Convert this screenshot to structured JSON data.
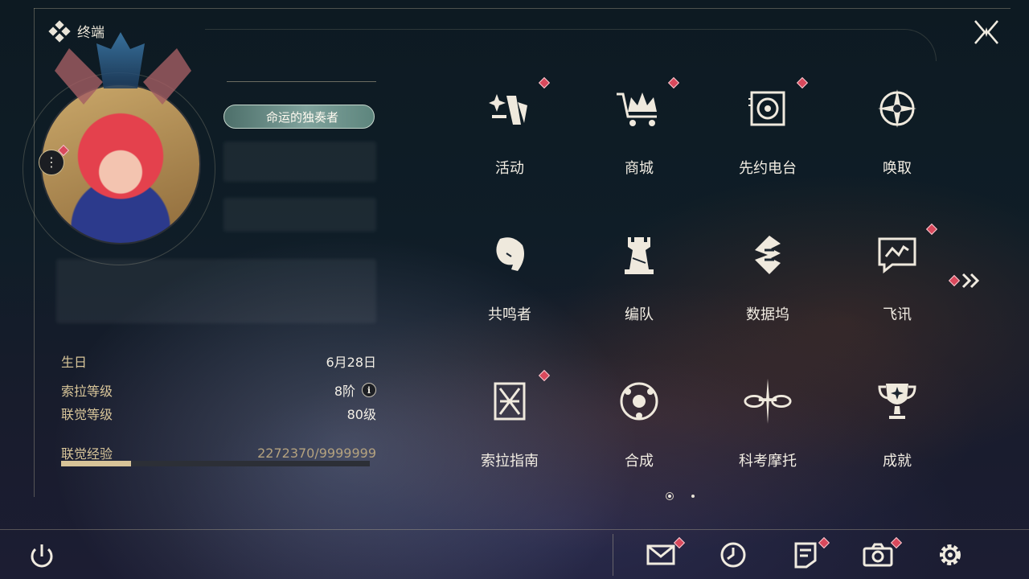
{
  "header": {
    "title": "终端",
    "logo_icon": "diamond-grid-icon"
  },
  "profile": {
    "title_chip": "命运的独奏者",
    "info": {
      "birthday_label": "生日",
      "birthday_value": "6月28日",
      "sola_level_label": "索拉等级",
      "sola_level_value": "8阶",
      "sync_level_label": "联觉等级",
      "sync_level_value": "80级",
      "exp_label": "联觉经验",
      "exp_value": "2272370/9999999",
      "exp_fraction": 0.2272
    }
  },
  "menu": [
    {
      "label": "活动",
      "icon": "sparkle-event-icon",
      "badge": true
    },
    {
      "label": "商城",
      "icon": "crown-cart-icon",
      "badge": true
    },
    {
      "label": "先约电台",
      "icon": "radio-speaker-icon",
      "badge": true
    },
    {
      "label": "唤取",
      "icon": "compass-star-icon",
      "badge": false
    },
    {
      "label": "共鸣者",
      "icon": "character-head-icon",
      "badge": false
    },
    {
      "label": "编队",
      "icon": "chess-piece-icon",
      "badge": false
    },
    {
      "label": "数据坞",
      "icon": "data-bank-icon",
      "badge": false
    },
    {
      "label": "飞讯",
      "icon": "chat-bubble-icon",
      "badge": true
    },
    {
      "label": "索拉指南",
      "icon": "guide-book-icon",
      "badge": true
    },
    {
      "label": "合成",
      "icon": "synthesis-orbit-icon",
      "badge": false
    },
    {
      "label": "科考摩托",
      "icon": "motorbike-icon",
      "badge": false
    },
    {
      "label": "成就",
      "icon": "trophy-icon",
      "badge": false
    }
  ],
  "pagination": {
    "current": 1,
    "total": 2
  },
  "bottom_bar": [
    {
      "name": "mail",
      "icon": "mail-icon",
      "badge": true
    },
    {
      "name": "timer",
      "icon": "clock-icon",
      "badge": false
    },
    {
      "name": "notes",
      "icon": "note-icon",
      "badge": true
    },
    {
      "name": "camera",
      "icon": "camera-icon",
      "badge": true
    },
    {
      "name": "settings",
      "icon": "gear-icon",
      "badge": false
    }
  ],
  "colors": {
    "accent_gold": "#d8c498",
    "badge_red": "#d9495c",
    "text_light": "#f2ede3"
  }
}
